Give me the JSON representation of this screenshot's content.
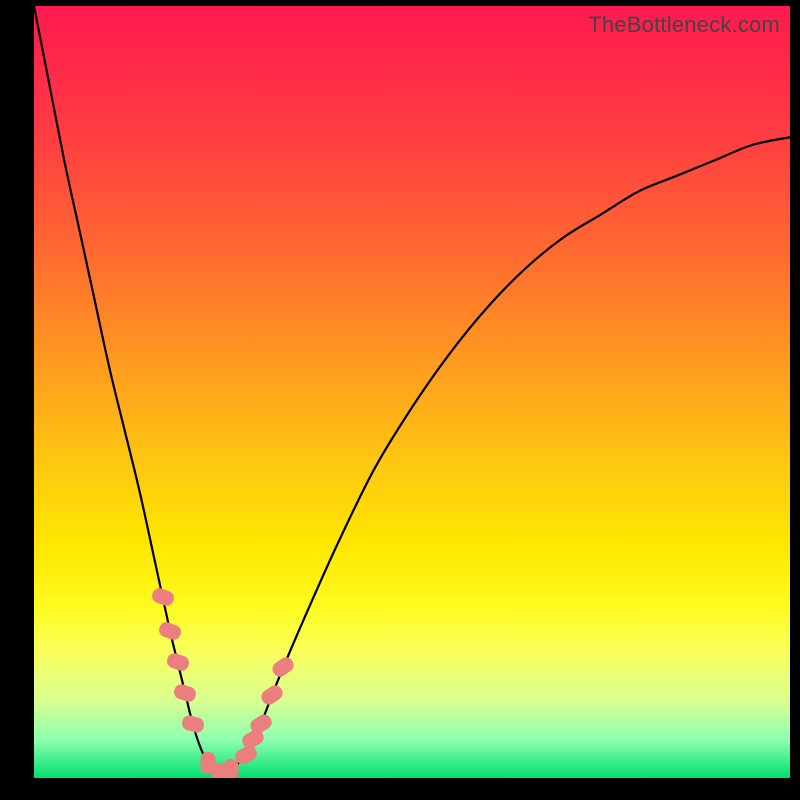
{
  "watermark": "TheBottleneck.com",
  "colors": {
    "background": "#000000",
    "gradient_top": "#ff1a4f",
    "gradient_mid": "#ffe800",
    "gradient_bottom": "#00e070",
    "curve": "#000000",
    "bead": "#eb7f80"
  },
  "chart_data": {
    "type": "line",
    "title": "",
    "xlabel": "",
    "ylabel": "",
    "xlim": [
      0,
      100
    ],
    "ylim": [
      0,
      100
    ],
    "x": [
      0,
      2,
      4,
      6,
      8,
      10,
      12,
      14,
      16,
      18,
      19,
      20,
      21,
      22,
      23,
      24,
      25,
      26,
      28,
      30,
      32,
      35,
      40,
      45,
      50,
      55,
      60,
      65,
      70,
      75,
      80,
      85,
      90,
      95,
      100
    ],
    "y": [
      100,
      90,
      80,
      71,
      62,
      53,
      45,
      37,
      28,
      19,
      15,
      11,
      7,
      4,
      2,
      1,
      0,
      1,
      3,
      7,
      12,
      19,
      30,
      40,
      48,
      55,
      61,
      66,
      70,
      73,
      76,
      78,
      80,
      82,
      83
    ],
    "beads": [
      {
        "on_curve_x": 17.0,
        "rotation_deg": -70
      },
      {
        "on_curve_x": 18.0,
        "rotation_deg": -70
      },
      {
        "on_curve_x": 19.0,
        "rotation_deg": -72
      },
      {
        "on_curve_x": 20.0,
        "rotation_deg": -72
      },
      {
        "on_curve_x": 21.0,
        "rotation_deg": -74
      },
      {
        "on_curve_x": 23.0,
        "rotation_deg": 0
      },
      {
        "on_curve_x": 24.5,
        "rotation_deg": 0
      },
      {
        "on_curve_x": 26.0,
        "rotation_deg": 0
      },
      {
        "on_curve_x": 28.0,
        "rotation_deg": 62
      },
      {
        "on_curve_x": 29.0,
        "rotation_deg": 60
      },
      {
        "on_curve_x": 30.0,
        "rotation_deg": 58
      },
      {
        "on_curve_x": 31.5,
        "rotation_deg": 56
      },
      {
        "on_curve_x": 33.0,
        "rotation_deg": 55
      }
    ],
    "annotations": []
  }
}
